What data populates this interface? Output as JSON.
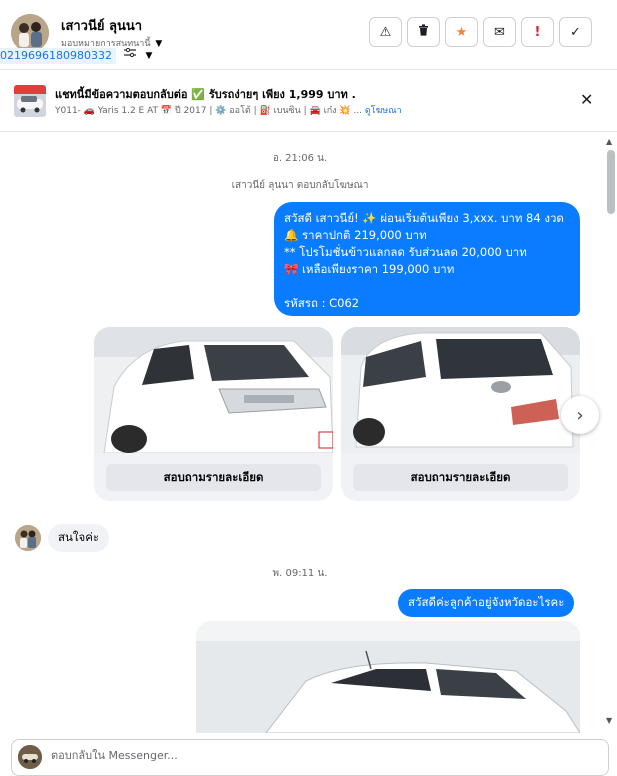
{
  "header": {
    "contact_name": "เสาวนีย์ ลุนนา",
    "assign_label": "มอบหมายการสนทนานี้",
    "phone": "0219696180980332",
    "actions": [
      {
        "name": "warning-icon",
        "glyph": "⚠"
      },
      {
        "name": "trash-icon",
        "glyph": "🗑"
      },
      {
        "name": "star-icon",
        "glyph": "★"
      },
      {
        "name": "mail-icon",
        "glyph": "✉"
      },
      {
        "name": "spam-icon",
        "glyph": "!"
      },
      {
        "name": "check-icon",
        "glyph": "✓"
      }
    ]
  },
  "ad": {
    "title": "แชทนี้มีข้อความตอบกลับต่อ ✅ รับรถง่ายๆ เพียง 1,999 บาท .",
    "subtitle": "Y011- 🚗 Yaris 1.2 E AT 📅 ปี 2017 | ⚙️ ออโต้ | ⛽ เบนซิน | 🚘 เก๋ง 💥 ...",
    "link": "ดูโฆษณา"
  },
  "chat": {
    "timestamp_1": "อ. 21:06 น.",
    "system_note": "เสาวนีย์ ลุนนา ตอบกลับโฆษณา",
    "outgoing_promo_lines": [
      "สวัสดี เสาวนีย์! ✨  ผ่อนเริ่มต้นเพียง 3,xxx. บาท 84 งวด",
      "🔔 ราคาปกติ 219,000 บาท",
      "** โปรโมชั่นข้าวแลกลด รับส่วนลด 20,000 บาท",
      "🎀  เหลือเพียงราคา 199,000 บาท",
      "",
      "รหัสรถ : C062"
    ],
    "card_button_1": "สอบถามรายละเอียด",
    "card_button_2": "สอบถามรายละเอียด",
    "incoming_reply": "สนใจค่ะ",
    "timestamp_2": "พ. 09:11 น.",
    "outgoing_question": "สวัสดีค่ะลูกค้าอยู่จังหวัดอะไรคะ"
  },
  "composer": {
    "placeholder": "ตอบกลับใน Messenger..."
  },
  "colors": {
    "outgoing_bubble": "#0a7cff",
    "incoming_bubble": "#f0f2f5",
    "link": "#1b74e4",
    "star": "#f5833f",
    "spam": "#e41e3f"
  }
}
